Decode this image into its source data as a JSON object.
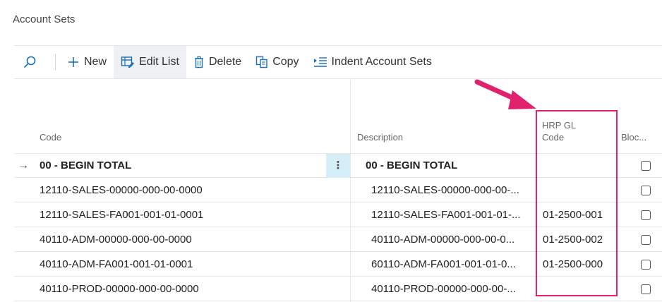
{
  "page": {
    "title": "Account Sets"
  },
  "toolbar": {
    "new_label": "New",
    "edit_list_label": "Edit List",
    "delete_label": "Delete",
    "copy_label": "Copy",
    "indent_label": "Indent Account Sets"
  },
  "columns": {
    "code": "Code",
    "description": "Description",
    "hrp_line1": "HRP GL",
    "hrp_line2": "Code",
    "blocked": "Bloc..."
  },
  "rows": [
    {
      "code": "00 - BEGIN TOTAL",
      "description": "00 - BEGIN TOTAL",
      "hrp": "",
      "bold": true,
      "current": true,
      "arrow": "→",
      "menu": "⋮"
    },
    {
      "code": "12110-SALES-00000-000-00-0000",
      "description": "12110-SALES-00000-000-00-...",
      "hrp": ""
    },
    {
      "code": "12110-SALES-FA001-001-01-0001",
      "description": "12110-SALES-FA001-001-01-...",
      "hrp": "01-2500-001"
    },
    {
      "code": "40110-ADM-00000-000-00-0000",
      "description": "40110-ADM-00000-000-00-0...",
      "hrp": "01-2500-002"
    },
    {
      "code": "40110-ADM-FA001-001-01-0001",
      "description": "60110-ADM-FA001-001-01-0...",
      "hrp": "01-2500-000"
    },
    {
      "code": "40110-PROD-00000-000-00-0000",
      "description": "40110-PROD-00000-000-00-...",
      "hrp": ""
    }
  ],
  "colors": {
    "highlight": "#e0226e",
    "selected_menu_bg": "#d6eef7",
    "accent": "#1b6fb6"
  }
}
